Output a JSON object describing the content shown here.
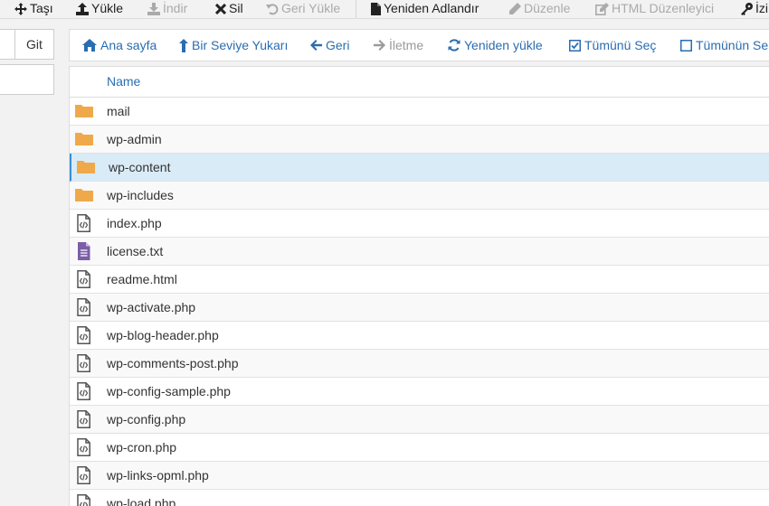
{
  "toolbar": {
    "move": "Taşı",
    "upload": "Yükle",
    "download": "İndir",
    "delete": "Sil",
    "restore": "Geri Yükle",
    "rename": "Yeniden Adlandır",
    "edit": "Düzenle",
    "html_editor": "HTML Düzenleyici",
    "permissions": "İzi"
  },
  "left": {
    "go_label": "Git"
  },
  "nav": {
    "home": "Ana sayfa",
    "up_one_level": "Bir Seviye Yukarı",
    "back": "Geri",
    "forward": "İletme",
    "reload": "Yeniden yükle",
    "select_all": "Tümünü Seç",
    "unselect_all": "Tümünün Se"
  },
  "table": {
    "column_name": "Name",
    "rows": [
      {
        "name": "mail",
        "type": "folder"
      },
      {
        "name": "wp-admin",
        "type": "folder"
      },
      {
        "name": "wp-content",
        "type": "folder",
        "selected": true
      },
      {
        "name": "wp-includes",
        "type": "folder"
      },
      {
        "name": "index.php",
        "type": "code"
      },
      {
        "name": "license.txt",
        "type": "text"
      },
      {
        "name": "readme.html",
        "type": "code"
      },
      {
        "name": "wp-activate.php",
        "type": "code"
      },
      {
        "name": "wp-blog-header.php",
        "type": "code"
      },
      {
        "name": "wp-comments-post.php",
        "type": "code"
      },
      {
        "name": "wp-config-sample.php",
        "type": "code"
      },
      {
        "name": "wp-config.php",
        "type": "code"
      },
      {
        "name": "wp-cron.php",
        "type": "code"
      },
      {
        "name": "wp-links-opml.php",
        "type": "code"
      },
      {
        "name": "wp-load.php",
        "type": "code"
      }
    ]
  },
  "colors": {
    "link": "#2a6db0",
    "folder": "#f0a94a",
    "text_file": "#7b5ea7",
    "selected_row": "#d9ebf7"
  }
}
